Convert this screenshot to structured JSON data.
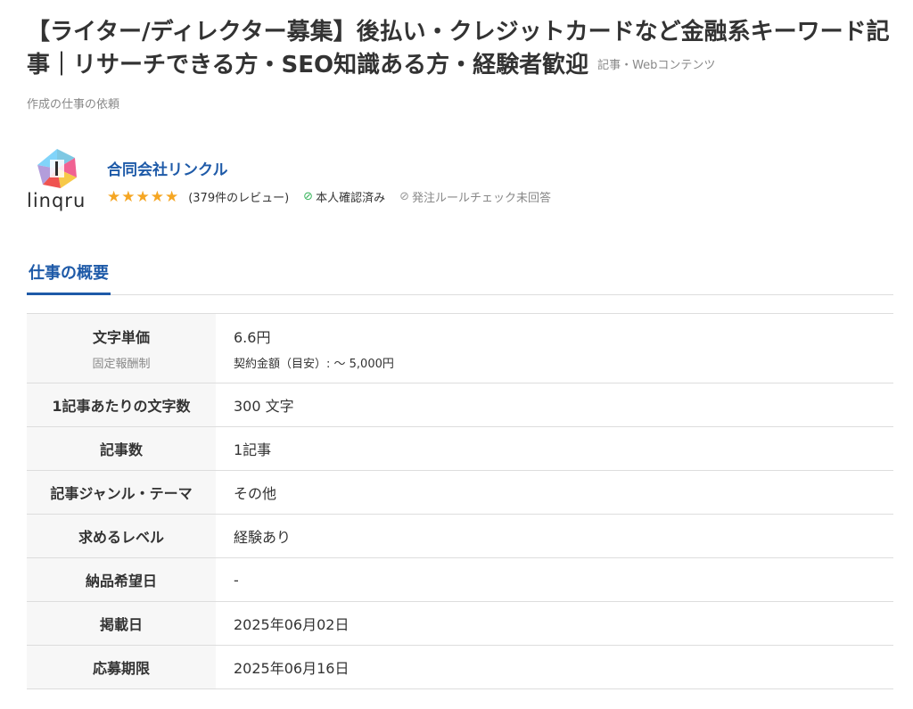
{
  "job": {
    "title": "【ライター/ディレクター募集】後払い・クレジットカードなど金融系キーワード記事｜リサーチできる方・SEO知識ある方・経験者歓迎",
    "category_inline": "記事・Webコンテンツ",
    "category_sub": "作成の仕事の依頼"
  },
  "client": {
    "logo_text": "linqru",
    "name": "合同会社リンクル",
    "stars": "★★★★★",
    "rating": 5,
    "reviews": "(379件のレビュー)",
    "verified": "本人確認済み",
    "rule_check": "発注ルールチェック未回答"
  },
  "tabs": {
    "overview": "仕事の概要"
  },
  "overview": {
    "rows": [
      {
        "label": "文字単価",
        "label_sub": "固定報酬制",
        "value": "6.6円",
        "value_sub": "契約金額（目安）: 〜 5,000円"
      },
      {
        "label": "1記事あたりの文字数",
        "value": "300 文字"
      },
      {
        "label": "記事数",
        "value": "1記事"
      },
      {
        "label": "記事ジャンル・テーマ",
        "value": "その他"
      },
      {
        "label": "求めるレベル",
        "value": "経験あり"
      },
      {
        "label": "納品希望日",
        "value": "-"
      },
      {
        "label": "掲載日",
        "value": "2025年06月02日"
      },
      {
        "label": "応募期限",
        "value": "2025年06月16日"
      }
    ]
  },
  "colors": {
    "brand_blue": "#1e5aa8",
    "star": "#f5a623",
    "verified_green": "#36b35a",
    "muted": "#888888"
  },
  "icons": {
    "verified": "check-circle-icon",
    "rule_check": "check-circle-outline-icon"
  }
}
